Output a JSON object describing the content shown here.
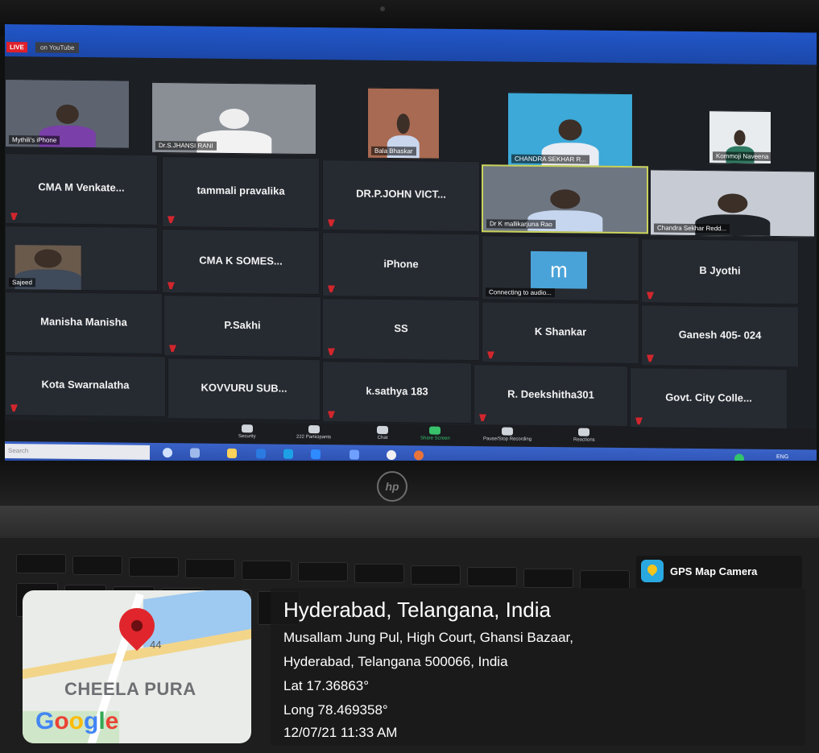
{
  "zoom": {
    "live_badge": "LIVE",
    "live_destination": "on YouTube",
    "tiles": [
      {
        "label": "Mythili's iPhone",
        "video": true
      },
      {
        "label": "Dr.S.JHANSI RANI",
        "video": true
      },
      {
        "label": "Bala Bhaskar",
        "video": true
      },
      {
        "label": "CHANDRA SEKHAR R...",
        "video": true
      },
      {
        "label": "Kommoji Naveena",
        "video": true
      },
      {
        "label": "CMA M Venkate...",
        "video": false
      },
      {
        "label": "tammali pravalika",
        "video": false
      },
      {
        "label": "DR.P.JOHN VICT...",
        "video": false
      },
      {
        "label": "Dr K mallikarjuna Rao",
        "video": true
      },
      {
        "label": "Chandra Sekhar Redd...",
        "video": true
      },
      {
        "label": "Sajeed",
        "video": true
      },
      {
        "label": "CMA K SOMES...",
        "video": false
      },
      {
        "label": "iPhone",
        "video": false
      },
      {
        "label": "Connecting to audio...",
        "video": false
      },
      {
        "label": "B Jyothi",
        "video": false
      },
      {
        "label": "Manisha Manisha",
        "video": false
      },
      {
        "label": "P.Sakhi",
        "video": false
      },
      {
        "label": "SS",
        "video": false
      },
      {
        "label": "K Shankar",
        "video": false
      },
      {
        "label": "Ganesh 405- 024",
        "video": false
      },
      {
        "label": "Kota Swarnalatha",
        "video": false
      },
      {
        "label": "KOVVURU SUB...",
        "video": false
      },
      {
        "label": "k.sathya 183",
        "video": false
      },
      {
        "label": "R. Deekshitha301",
        "video": false
      },
      {
        "label": "Govt. City Colle...",
        "video": false
      }
    ],
    "avatar_letter": "m",
    "toolbar": {
      "security": "Security",
      "participants": "Participants",
      "participant_count": "222",
      "chat": "Chat",
      "share_screen": "Share Screen",
      "recording": "Pause/Stop Recording",
      "reactions": "Reactions"
    },
    "taskbar_search": "Search",
    "tray_lang": "ENG"
  },
  "laptop": {
    "brand": "hp"
  },
  "gps": {
    "app_name": "GPS Map Camera",
    "title": "Hyderabad, Telangana, India",
    "address_line1": "Musallam Jung Pul, High Court, Ghansi Bazaar,",
    "address_line2": "Hyderabad, Telangana 500066, India",
    "lat": "Lat 17.36863°",
    "long": "Long 78.469358°",
    "datetime": "12/07/21 11:33 AM",
    "map": {
      "road_number": "44",
      "area_label": "CHEELA PURA",
      "logo_text": "Google"
    }
  }
}
